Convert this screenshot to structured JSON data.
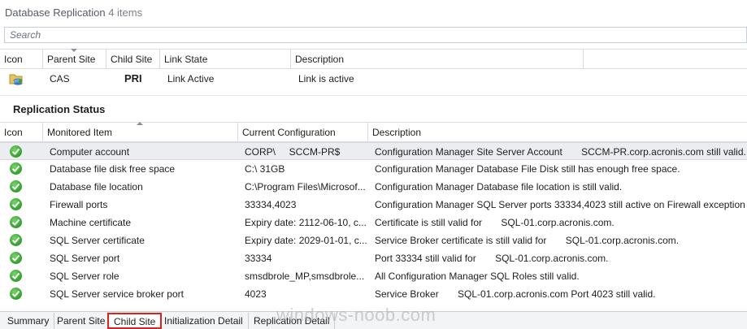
{
  "header": {
    "title": "Database Replication",
    "count": "4 items"
  },
  "search": {
    "placeholder": "Search"
  },
  "replication_grid": {
    "columns": [
      "Icon",
      "Parent Site",
      "Child Site",
      "Link State",
      "Description"
    ],
    "rows": [
      {
        "icon": "database-site-icon",
        "parent_site": "CAS",
        "child_site": "PRI",
        "link_state": "Link Active",
        "description": "Link is active"
      }
    ]
  },
  "status_section": {
    "title": "Replication Status",
    "columns": [
      "Icon",
      "Monitored Item",
      "Current Configuration",
      "Description"
    ],
    "rows": [
      {
        "icon": "check-icon",
        "item": "Computer account",
        "config": "CORP\\     SCCM-PR$",
        "description": "Configuration Manager Site Server Account       SCCM-PR.corp.acronis.com still valid."
      },
      {
        "icon": "check-icon",
        "item": "Database file disk free space",
        "config": "C:\\ 31GB",
        "description": "Configuration Manager Database File Disk still has enough free space."
      },
      {
        "icon": "check-icon",
        "item": "Database file location",
        "config": "C:\\Program Files\\Microsof...",
        "description": "Configuration Manager Database file location is still valid."
      },
      {
        "icon": "check-icon",
        "item": "Firewall ports",
        "config": "33334,4023",
        "description": "Configuration Manager SQL Server ports 33334,4023 still active on Firewall exception."
      },
      {
        "icon": "check-icon",
        "item": "Machine certificate",
        "config": "Expiry date: 2112-06-10, c...",
        "description": "Certificate is still valid for       SQL-01.corp.acronis.com."
      },
      {
        "icon": "check-icon",
        "item": "SQL Server certificate",
        "config": "Expiry date: 2029-01-01, c...",
        "description": "Service Broker certificate is still valid for       SQL-01.corp.acronis.com."
      },
      {
        "icon": "check-icon",
        "item": "SQL Server port",
        "config": "33334",
        "description": "Port 33334 still valid for       SQL-01.corp.acronis.com."
      },
      {
        "icon": "check-icon",
        "item": "SQL Server role",
        "config": "smsdbrole_MP,smsdbrole...",
        "description": "All Configuration Manager SQL Roles still valid."
      },
      {
        "icon": "check-icon",
        "item": "SQL Server service broker port",
        "config": "4023",
        "description": "Service Broker       SQL-01.corp.acronis.com Port 4023 still valid."
      }
    ]
  },
  "tabs": {
    "items": [
      "Summary",
      "Parent Site",
      "Child Site",
      "Initialization Detail",
      "Replication Detail"
    ],
    "active": "Child Site"
  },
  "watermark": "windows-noob.com",
  "colors": {
    "accent_active_tab": "#e0201b",
    "check_green": "#2f9e2a"
  }
}
